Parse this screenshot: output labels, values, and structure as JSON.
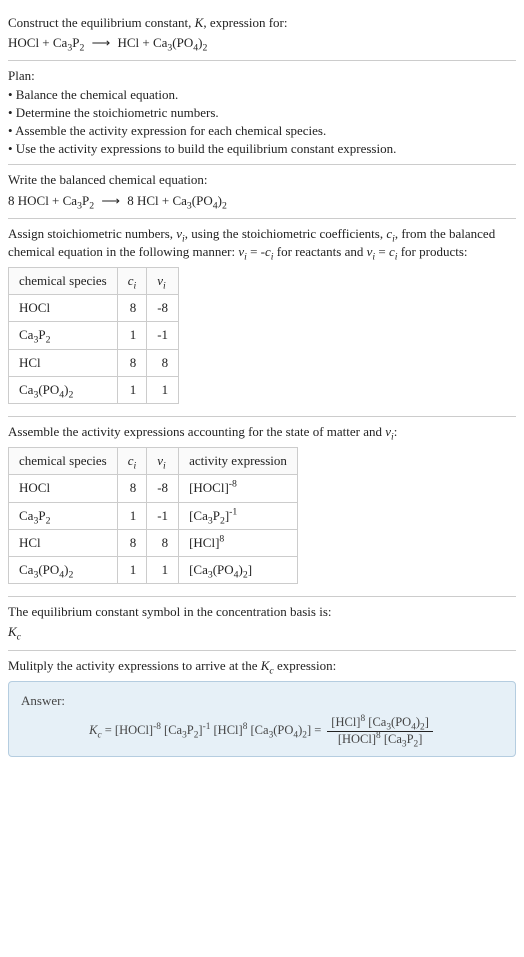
{
  "intro": {
    "title_prefix": "Construct the equilibrium constant, ",
    "title_symbol": "K",
    "title_suffix": ", expression for:",
    "equation_lhs": "HOCl + Ca",
    "equation_rhs_1": "P",
    "equation_after_arrow_1": "HCl + Ca",
    "equation_after_arrow_2": "(PO",
    "equation_after_arrow_3": ")",
    "arrow": "⟶"
  },
  "plan": {
    "heading": "Plan:",
    "b1": "• Balance the chemical equation.",
    "b2": "• Determine the stoichiometric numbers.",
    "b3": "• Assemble the activity expression for each chemical species.",
    "b4": "• Use the activity expressions to build the equilibrium constant expression."
  },
  "balanced": {
    "heading": "Write the balanced chemical equation:",
    "eq_1": "8 HOCl + Ca",
    "eq_2": "P",
    "eq_3_after_arrow": "8 HCl + Ca",
    "eq_4": "(PO",
    "eq_5": ")",
    "arrow": "⟶"
  },
  "stoich": {
    "text_1": "Assign stoichiometric numbers, ",
    "nu": "ν",
    "text_2": ", using the stoichiometric coefficients, ",
    "c": "c",
    "text_3": ", from the balanced chemical equation in the following manner: ",
    "rel1_a": "ν",
    "rel1_b": " = -",
    "rel1_c": "c",
    "text_reactants": " for reactants and ",
    "rel2_a": "ν",
    "rel2_b": " = ",
    "rel2_c": "c",
    "text_products": " for products:",
    "i": "i",
    "col_species": "chemical species",
    "rows": [
      {
        "species_1": "HOCl",
        "species_2": "",
        "species_3": "",
        "ci": "8",
        "vi": "-8"
      },
      {
        "species_1": "Ca",
        "species_2": "P",
        "species_3": "",
        "sub1": "3",
        "sub2": "2",
        "ci": "1",
        "vi": "-1"
      },
      {
        "species_1": "HCl",
        "species_2": "",
        "species_3": "",
        "ci": "8",
        "vi": "8"
      },
      {
        "species_1": "Ca",
        "species_2": "(PO",
        "species_3": ")",
        "sub1": "3",
        "sub2": "4",
        "sub3": "2",
        "ci": "1",
        "vi": "1"
      }
    ]
  },
  "activity": {
    "heading_1": "Assemble the activity expressions accounting for the state of matter and ",
    "heading_2": ":",
    "nu": "ν",
    "i": "i",
    "col_species": "chemical species",
    "col_c": "c",
    "col_v": "ν",
    "col_activity": "activity expression",
    "rows": [
      {
        "ci": "8",
        "vi": "-8"
      },
      {
        "ci": "1",
        "vi": "-1"
      },
      {
        "ci": "8",
        "vi": "8"
      },
      {
        "ci": "1",
        "vi": "1"
      }
    ]
  },
  "kc_basis": {
    "text": "The equilibrium constant symbol in the concentration basis is:",
    "symbol_k": "K",
    "symbol_c": "c"
  },
  "multiply": {
    "text_1": "Mulitply the activity expressions to arrive at the ",
    "k": "K",
    "c": "c",
    "text_2": " expression:"
  },
  "answer": {
    "label": "Answer:",
    "k": "K",
    "c": "c",
    "eq": " = "
  },
  "sub": {
    "s3": "3",
    "s2": "2",
    "s4": "4",
    "si": "i"
  }
}
